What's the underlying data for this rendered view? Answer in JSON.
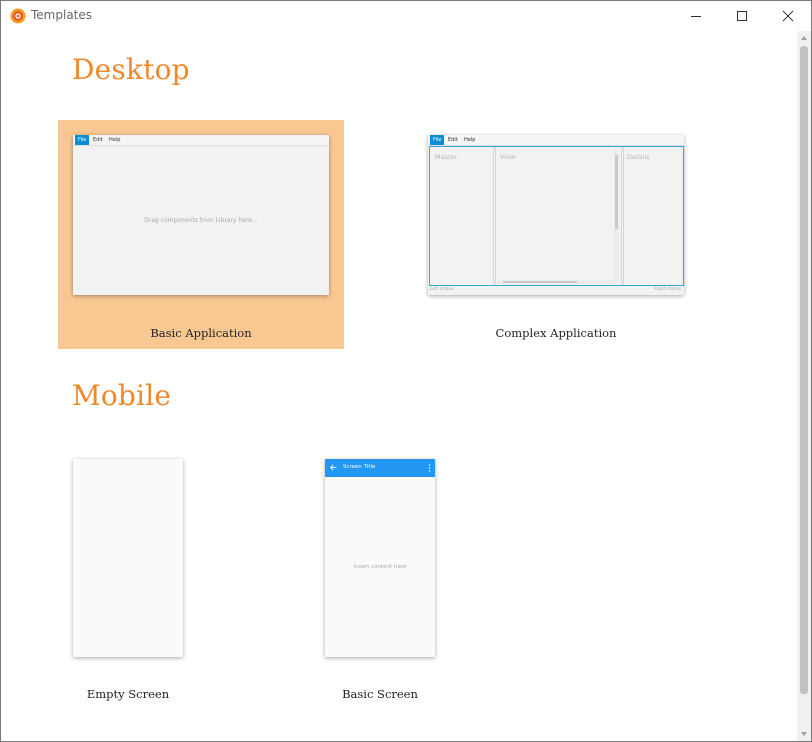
{
  "window": {
    "title": "Templates",
    "controls": [
      "minimize",
      "maximize",
      "close"
    ]
  },
  "sections": {
    "desktop": {
      "title": "Desktop",
      "templates": [
        {
          "label": "Basic Application",
          "selected": true,
          "menu": [
            "File",
            "Edit",
            "Help"
          ],
          "hint": "Drag components from Library here..."
        },
        {
          "label": "Complex Application",
          "selected": false,
          "menu": [
            "File",
            "Edit",
            "Help"
          ],
          "panes": [
            "Master",
            "View",
            "Details"
          ],
          "left_status": "Left status",
          "right_status": "Right status"
        }
      ]
    },
    "mobile": {
      "title": "Mobile",
      "templates": [
        {
          "label": "Empty Screen",
          "selected": false
        },
        {
          "label": "Basic Screen",
          "selected": false,
          "screen_title": "Screen Title",
          "hint": "Insert content here"
        }
      ]
    }
  },
  "colors": {
    "accent": "#f0892c",
    "selection": "#f8c792",
    "menu_active": "#0a8ed6",
    "mobile_toolbar": "#2196f3"
  },
  "icons": {
    "app": "scene-builder-logo-icon",
    "back": "arrow-left-icon",
    "overflow": "more-vertical-icon"
  }
}
